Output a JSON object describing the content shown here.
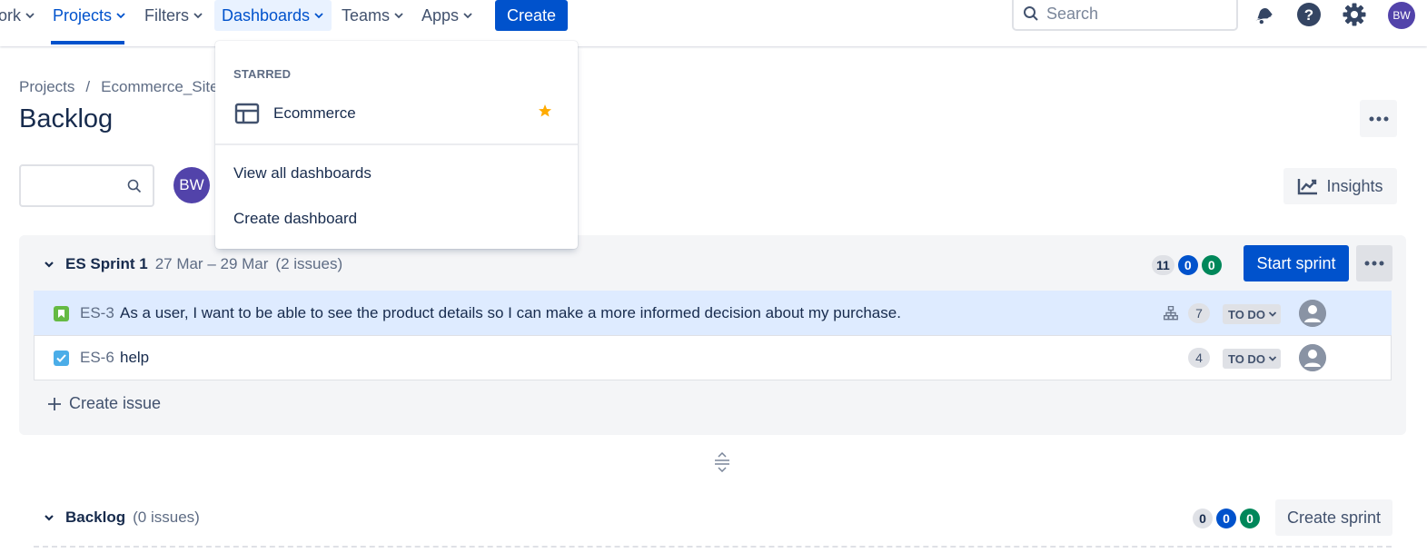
{
  "topnav": {
    "work_label": "ork",
    "projects_label": "Projects",
    "filters_label": "Filters",
    "dashboards_label": "Dashboards",
    "teams_label": "Teams",
    "apps_label": "Apps",
    "create_label": "Create",
    "search_placeholder": "Search",
    "user_initials": "BW",
    "icons": [
      "notification-icon",
      "help-icon",
      "settings-icon"
    ]
  },
  "dropdown": {
    "heading": "STARRED",
    "starred_item": "Ecommerce",
    "view_all": "View all dashboards",
    "create_dashboard": "Create dashboard",
    "star_color": "#ffab00"
  },
  "breadcrumb": {
    "projects": "Projects",
    "separator": "/",
    "project": "Ecommerce_Site"
  },
  "page": {
    "title": "Backlog",
    "avatar_initials": "BW",
    "insights_label": "Insights"
  },
  "sprint": {
    "name": "ES Sprint 1",
    "dates": "27 Mar – 29 Mar",
    "count": "(2 issues)",
    "badge_todo": "11",
    "badge_inprogress": "0",
    "badge_done": "0",
    "start_label": "Start sprint",
    "issues": [
      {
        "key": "ES-3",
        "type": "story",
        "summary": "As a user, I want to be able to see the product details so I can make a more informed decision about my purchase.",
        "points": "7",
        "status": "TO DO"
      },
      {
        "key": "ES-6",
        "type": "task",
        "summary": "help",
        "points": "4",
        "status": "TO DO"
      }
    ],
    "create_issue_label": "Create issue"
  },
  "backlog": {
    "name": "Backlog",
    "count": "(0 issues)",
    "badge_todo": "0",
    "badge_inprogress": "0",
    "badge_done": "0",
    "create_sprint_label": "Create sprint"
  },
  "colors": {
    "brand": "#0052cc",
    "story": "#65ba43",
    "task": "#4bade8",
    "done": "#00875a"
  }
}
